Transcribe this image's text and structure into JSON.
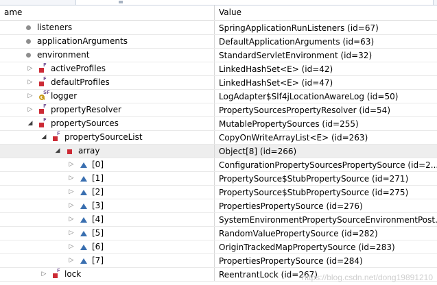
{
  "header": {
    "name": "ame",
    "value": "Value"
  },
  "rows": [
    {
      "name": "listeners",
      "value": "SpringApplicationRunListeners  (id=67)",
      "icon": "default-field-icon",
      "expander": ""
    },
    {
      "name": "applicationArguments",
      "value": "DefaultApplicationArguments  (id=63)",
      "icon": "default-field-icon",
      "expander": ""
    },
    {
      "name": "environment",
      "value": "StandardServletEnvironment  (id=32)",
      "icon": "default-field-icon",
      "expander": ""
    },
    {
      "name": "activeProfiles",
      "value": "LinkedHashSet<E>  (id=42)",
      "icon": "private-field-icon",
      "expander": "collapsed"
    },
    {
      "name": "defaultProfiles",
      "value": "LinkedHashSet<E>  (id=47)",
      "icon": "private-field-icon",
      "expander": "collapsed"
    },
    {
      "name": "logger",
      "value": "LogAdapter$Slf4jLocationAwareLog  (id=50)",
      "icon": "static-final-field-icon",
      "expander": "collapsed"
    },
    {
      "name": "propertyResolver",
      "value": "PropertySourcesPropertyResolver  (id=54)",
      "icon": "private-field-icon",
      "expander": "collapsed"
    },
    {
      "name": "propertySources",
      "value": "MutablePropertySources  (id=255)",
      "icon": "private-field-icon",
      "expander": "expanded"
    },
    {
      "name": "propertySourceList",
      "value": "CopyOnWriteArrayList<E>  (id=263)",
      "icon": "private-field-icon",
      "expander": "expanded"
    },
    {
      "name": "array",
      "value": "Object[8]  (id=266)",
      "icon": "array-field-icon",
      "expander": "expanded"
    },
    {
      "name": "[0]",
      "value": "ConfigurationPropertySourcesPropertySource  (id=2...",
      "icon": "array-element-icon",
      "expander": "collapsed"
    },
    {
      "name": "[1]",
      "value": "PropertySource$StubPropertySource  (id=271)",
      "icon": "array-element-icon",
      "expander": "collapsed"
    },
    {
      "name": "[2]",
      "value": "PropertySource$StubPropertySource  (id=275)",
      "icon": "array-element-icon",
      "expander": "collapsed"
    },
    {
      "name": "[3]",
      "value": "PropertiesPropertySource  (id=276)",
      "icon": "array-element-icon",
      "expander": "collapsed"
    },
    {
      "name": "[4]",
      "value": "SystemEnvironmentPropertySourceEnvironmentPost...",
      "icon": "array-element-icon",
      "expander": "collapsed"
    },
    {
      "name": "[5]",
      "value": "RandomValuePropertySource  (id=282)",
      "icon": "array-element-icon",
      "expander": "collapsed"
    },
    {
      "name": "[6]",
      "value": "OriginTrackedMapPropertySource  (id=283)",
      "icon": "array-element-icon",
      "expander": "collapsed"
    },
    {
      "name": "[7]",
      "value": "PropertiesPropertySource  (id=284)",
      "icon": "array-element-icon",
      "expander": "collapsed"
    },
    {
      "name": "lock",
      "value": "ReentrantLock  (id=267)",
      "icon": "private-field-icon",
      "expander": "collapsed"
    }
  ],
  "watermark": "https://blog.csdn.net/dong19891210"
}
